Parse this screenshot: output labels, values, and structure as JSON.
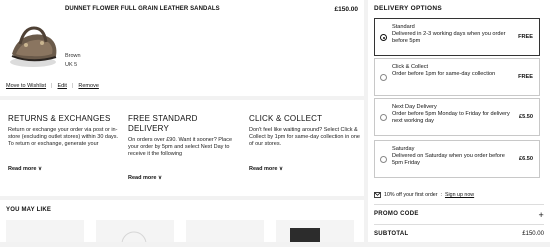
{
  "product": {
    "name": "DUNNET FLOWER FULL GRAIN LEATHER SANDALS",
    "price": "£150.00",
    "color": "Brown",
    "size": "UK 5",
    "actions": {
      "wishlist": "Move to Wishlist",
      "edit": "Edit",
      "remove": "Remove",
      "separator": "|"
    }
  },
  "info": [
    {
      "title": "RETURNS & EXCHANGES",
      "body": "Return or exchange your order via post or in-store (excluding outlet stores) within 30 days. To return or exchange, generate your",
      "read_more": "Read more ∨"
    },
    {
      "title": "FREE STANDARD DELIVERY",
      "body": "On orders over £90. Want it sooner? Place your order by 5pm and select Next Day to receive it the following",
      "read_more": "Read more ∨"
    },
    {
      "title": "CLICK & COLLECT",
      "body": "Don't feel like waiting around? Select Click & Collect by 1pm for same-day collection in one of our stores.",
      "read_more": "Read more ∨"
    }
  ],
  "you_may_like": {
    "title": "YOU MAY LIKE"
  },
  "delivery": {
    "title": "DELIVERY OPTIONS",
    "options": [
      {
        "name": "Standard",
        "desc": "Delivered in 2-3 working days when you order before 5pm",
        "price": "FREE",
        "selected": true
      },
      {
        "name": "Click & Collect",
        "desc": "Order before 1pm for same-day collection",
        "price": "FREE",
        "selected": false
      },
      {
        "name": "Next Day Delivery",
        "desc": "Order before 5pm Monday to Friday for delivery next working day",
        "price": "£5.50",
        "selected": false
      },
      {
        "name": "Saturday",
        "desc": "Delivered on Saturday when you order before 5pm Friday",
        "price": "£6.50",
        "selected": false
      }
    ],
    "promo_note": "10% off your first order",
    "sign_up": "Sign up now",
    "promo_code": "PROMO CODE",
    "promo_toggle": "+",
    "subtotal_label": "SUBTOTAL",
    "subtotal_value": "£150.00"
  }
}
